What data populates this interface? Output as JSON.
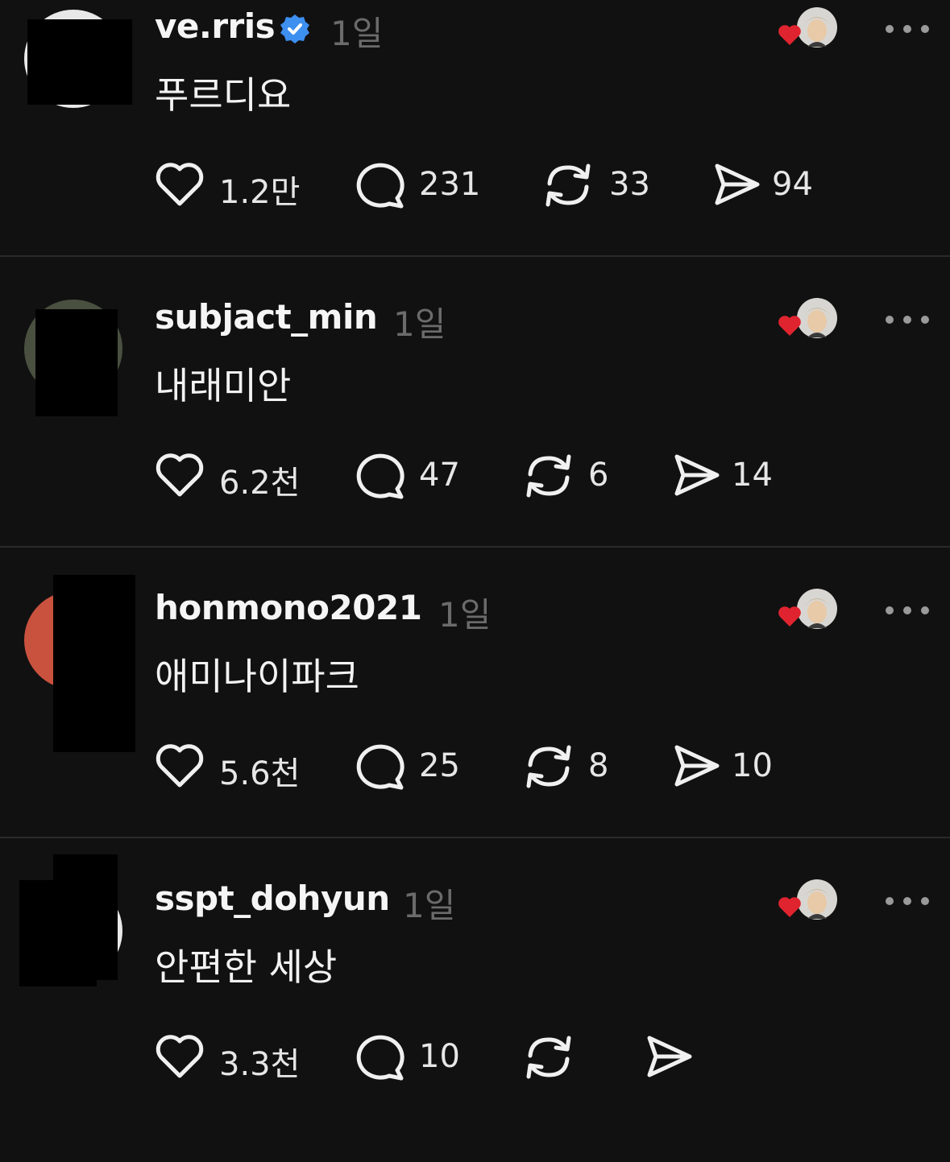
{
  "posts": [
    {
      "username": "ve.rris",
      "verified": true,
      "time": "1일",
      "text": "푸르디요",
      "likes": "1.2만",
      "replies": "231",
      "reposts": "33",
      "shares": "94"
    },
    {
      "username": "subjact_min",
      "verified": false,
      "time": "1일",
      "text": "내래미안",
      "likes": "6.2천",
      "replies": "47",
      "reposts": "6",
      "shares": "14"
    },
    {
      "username": "honmono2021",
      "verified": false,
      "time": "1일",
      "text": "애미나이파크",
      "likes": "5.6천",
      "replies": "25",
      "reposts": "8",
      "shares": "10"
    },
    {
      "username": "sspt_dohyun",
      "verified": false,
      "time": "1일",
      "text": "안편한 세상",
      "likes": "3.3천",
      "replies": "10",
      "reposts": "",
      "shares": ""
    }
  ],
  "colors": {
    "background": "#111112",
    "heart_badge": "#e0242f",
    "verified": "#3d8ff0"
  },
  "icons": [
    "heart-icon",
    "comment-icon",
    "repost-icon",
    "share-icon",
    "more-icon",
    "verified-icon"
  ]
}
